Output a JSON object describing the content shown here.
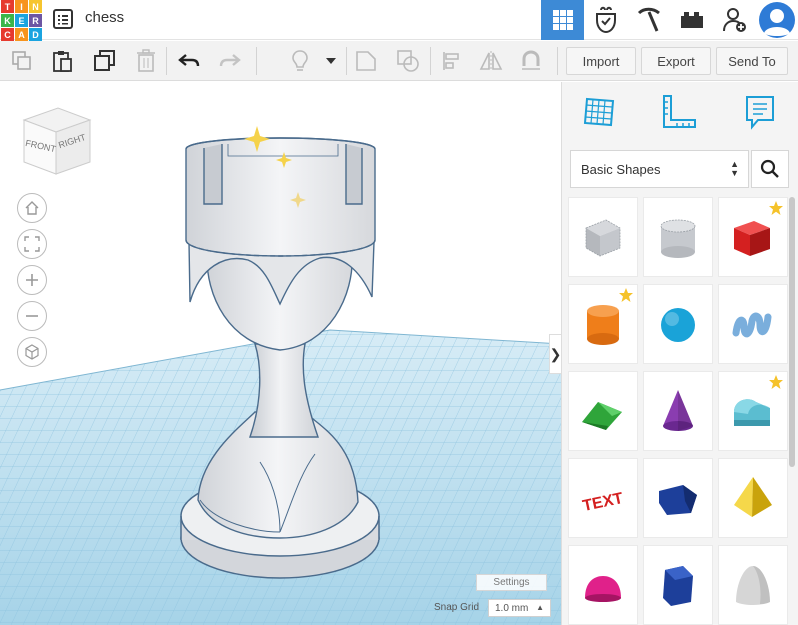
{
  "app": {
    "logo_letters": [
      "T",
      "I",
      "N",
      "K",
      "E",
      "R",
      "C",
      "A",
      "D"
    ],
    "logo_colors": [
      "#e63a2e",
      "#f7941d",
      "#f6c52f",
      "#3ab54a",
      "#1ba4e0",
      "#6d56a3",
      "#e63a2e",
      "#f7941d",
      "#1ba4e0"
    ],
    "project_title": "chess"
  },
  "header": {
    "icons": [
      "grid-view-icon",
      "brick-icon",
      "pickaxe-icon",
      "lego-brick-icon",
      "add-user-icon",
      "avatar-icon"
    ],
    "accent_color": "#3d8ad6"
  },
  "toolbar": {
    "import_label": "Import",
    "export_label": "Export",
    "send_to_label": "Send To"
  },
  "viewcube": {
    "front_label": "FRONT",
    "right_label": "RIGHT"
  },
  "viewport": {
    "settings_label": "Settings",
    "snap_grid_label": "Snap Grid",
    "snap_grid_value": "1.0 mm",
    "grid_color": "#aad6ea",
    "collapse_glyph": "❯"
  },
  "panel": {
    "tabs": [
      "workplane-grid-icon",
      "ruler-icon",
      "notes-icon"
    ],
    "shape_library": "Basic Shapes",
    "shapes": [
      {
        "name": "box-hole",
        "color": "#b9bcc2",
        "favorite": false
      },
      {
        "name": "cylinder-hole",
        "color": "#b9bcc2",
        "favorite": false
      },
      {
        "name": "box",
        "color": "#d42020",
        "favorite": true
      },
      {
        "name": "cylinder",
        "color": "#ef7e1a",
        "favorite": true
      },
      {
        "name": "sphere",
        "color": "#1aa3d8",
        "favorite": false
      },
      {
        "name": "scribble",
        "color": "#7aaedc",
        "favorite": false
      },
      {
        "name": "roof",
        "color": "#2fa53a",
        "favorite": false
      },
      {
        "name": "cone",
        "color": "#8a3db0",
        "favorite": false
      },
      {
        "name": "round-roof",
        "color": "#5bbdd0",
        "favorite": true
      },
      {
        "name": "text",
        "color": "#d42020",
        "favorite": false
      },
      {
        "name": "prism",
        "color": "#1d3f9a",
        "favorite": false
      },
      {
        "name": "pyramid",
        "color": "#f0c817",
        "favorite": false
      },
      {
        "name": "half-sphere",
        "color": "#e0218a",
        "favorite": false
      },
      {
        "name": "polygon",
        "color": "#1d3f9a",
        "favorite": false
      },
      {
        "name": "paraboloid",
        "color": "#bdbdbd",
        "favorite": false
      }
    ],
    "star_color": "#f5c22a"
  }
}
